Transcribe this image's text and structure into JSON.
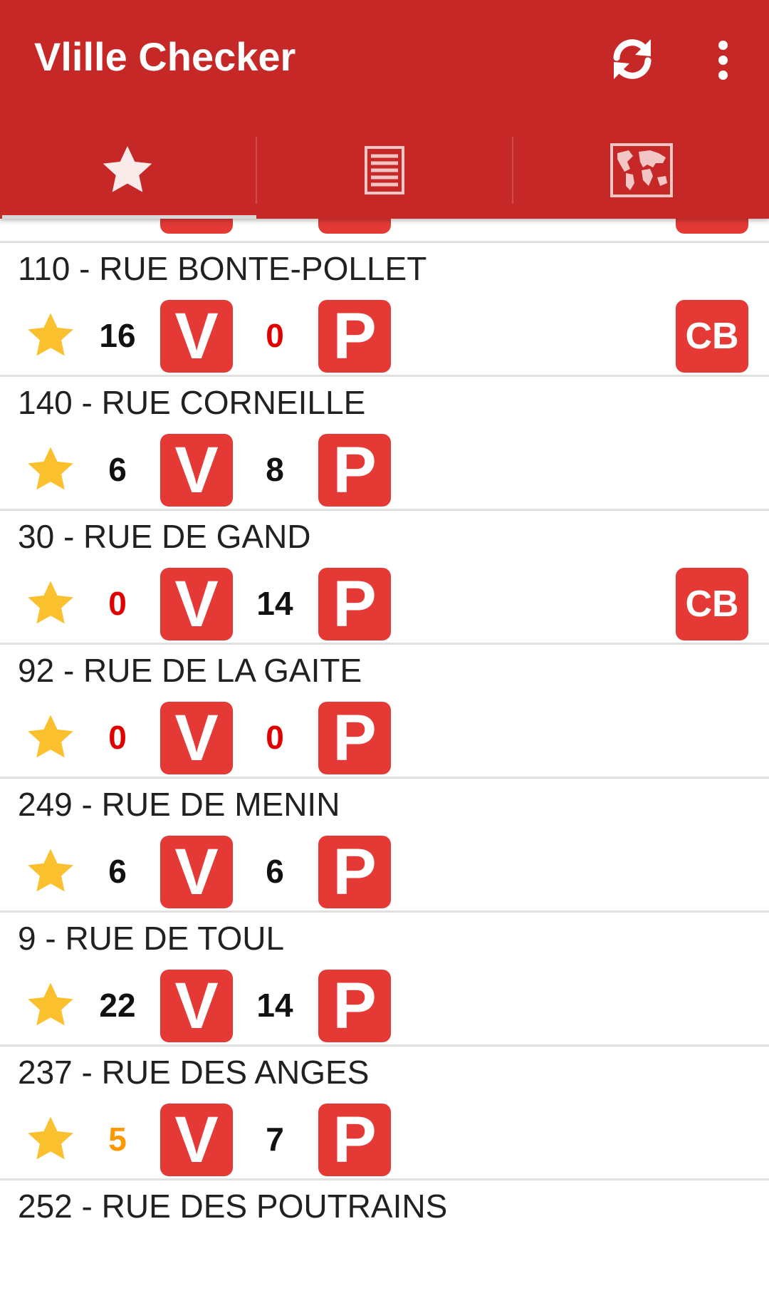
{
  "app": {
    "title": "Vlille Checker"
  },
  "toolbar": {
    "actions": [
      {
        "icon": "refresh-icon"
      },
      {
        "icon": "overflow-menu-icon"
      }
    ]
  },
  "tabs": [
    {
      "icon": "star-icon",
      "selected": true
    },
    {
      "icon": "list-icon",
      "selected": false
    },
    {
      "icon": "map-icon",
      "selected": false
    }
  ],
  "badges": {
    "bikes": "V",
    "stands": "P",
    "card": "CB"
  },
  "colors": {
    "primary": "#c62828",
    "badge": "#e53935",
    "star": "#fbc02d",
    "zero": "#e10000",
    "low": "#ff9800"
  },
  "stations": [
    {
      "name": "110 - RUE BONTE-POLLET",
      "bikes": "16",
      "stands": "0",
      "card": true
    },
    {
      "name": "140 - RUE CORNEILLE",
      "bikes": "6",
      "stands": "8",
      "card": false
    },
    {
      "name": "30 - RUE DE GAND",
      "bikes": "0",
      "stands": "14",
      "card": true
    },
    {
      "name": "92 - RUE DE LA GAITE",
      "bikes": "0",
      "stands": "0",
      "card": false
    },
    {
      "name": "249 - RUE DE MENIN",
      "bikes": "6",
      "stands": "6",
      "card": false
    },
    {
      "name": "9 - RUE DE TOUL",
      "bikes": "22",
      "stands": "14",
      "card": false
    },
    {
      "name": "237 - RUE DES ANGES",
      "bikes": "5",
      "stands": "7",
      "card": false
    },
    {
      "name": "252 - RUE DES POUTRAINS",
      "bikes": "",
      "stands": "",
      "card": false
    }
  ]
}
